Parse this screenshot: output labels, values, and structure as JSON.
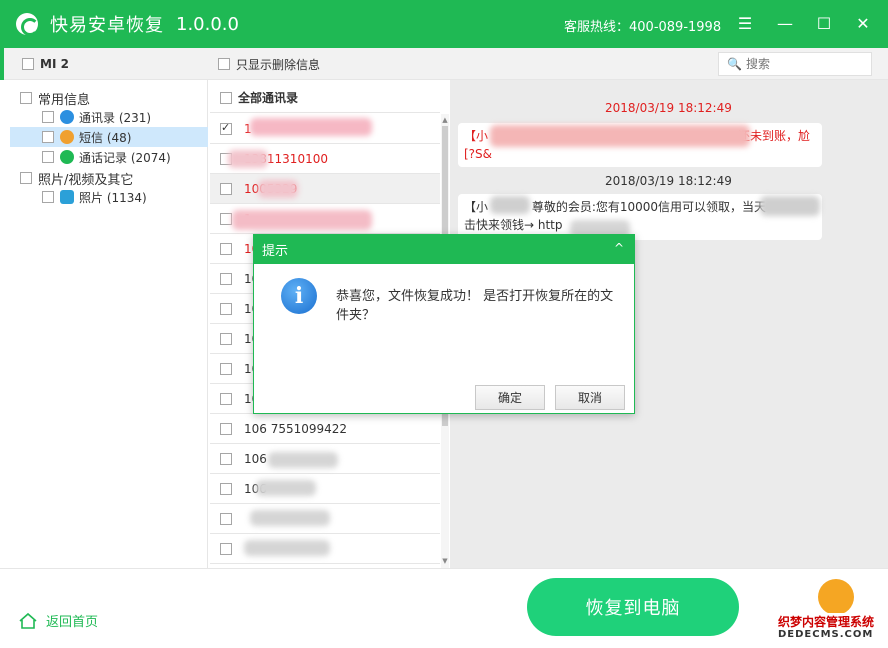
{
  "window": {
    "title": "快易安卓恢复",
    "version": "1.0.0.0",
    "hotline": "客服热线：400-089-1998"
  },
  "header": {
    "device_label": "MI 2",
    "only_deleted_label": "只显示删除信息",
    "search_placeholder": "搜索"
  },
  "tree": {
    "group1": "常用信息",
    "contacts": "通讯录 (231)",
    "sms": "短信 (48)",
    "calls": "通话记录 (2074)",
    "group2": "照片/视频及其它",
    "photos": "照片 (1134)"
  },
  "list": {
    "header": "全部通讯录",
    "rows": [
      {
        "number": "1",
        "checked": true,
        "red": true
      },
      {
        "number": "13811310100",
        "checked": false,
        "red": true
      },
      {
        "number": "1005329",
        "checked": false,
        "red": true
      },
      {
        "number": "1",
        "checked": false,
        "red": true
      },
      {
        "number": "10",
        "checked": false,
        "red": true
      },
      {
        "number": "10",
        "checked": false,
        "red": false
      },
      {
        "number": "10",
        "checked": false,
        "red": false
      },
      {
        "number": "10",
        "checked": false,
        "red": false
      },
      {
        "number": "10",
        "checked": false,
        "red": false
      },
      {
        "number": "10",
        "checked": false,
        "red": false
      },
      {
        "number": "106 7551099422",
        "checked": false,
        "red": false
      },
      {
        "number": "106",
        "checked": false,
        "red": false
      },
      {
        "number": "106",
        "checked": false,
        "red": false
      },
      {
        "number": "",
        "checked": false,
        "red": false
      },
      {
        "number": "",
        "checked": false,
        "red": false
      }
    ]
  },
  "messages": {
    "date1": "2018/03/19 18:12:49",
    "msg1_line1_start": "【小",
    "msg1_line1_end": "还未到账，尬",
    "msg1_line2": "[?S&",
    "date2": "2018/03/19 18:12:49",
    "msg2_line1_start": "【小",
    "msg2_line1_mid": "尊敬的会员:您有10000信用可以领取，当天",
    "msg2_line2": "击快来领钱→ http"
  },
  "dialog": {
    "title": "提示",
    "message": "恭喜您，文件恢复成功！ 是否打开恢复所在的文件夹？",
    "ok": "确定",
    "cancel": "取消"
  },
  "bottom": {
    "home": "返回首页",
    "recover": "恢复到电脑",
    "watermark1": "织梦内容管理系统",
    "watermark2": "DEDECMS.COM"
  },
  "colors": {
    "accent": "#1fb954",
    "button": "#1fd17a",
    "red": "#e02020"
  }
}
